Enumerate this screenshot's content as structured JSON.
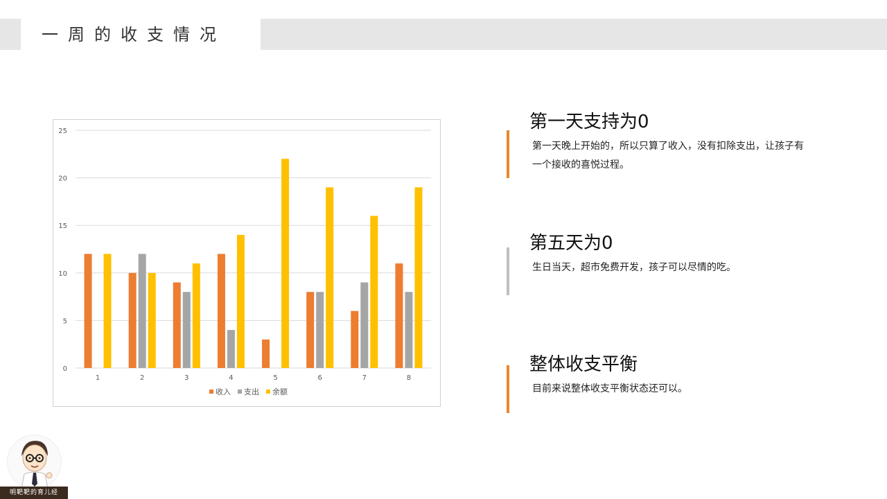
{
  "slide": {
    "title": "一周的收支情况"
  },
  "chart_data": {
    "type": "bar",
    "categories": [
      "1",
      "2",
      "3",
      "4",
      "5",
      "6",
      "7",
      "8"
    ],
    "series": [
      {
        "name": "收入",
        "color": "#ed7d31",
        "values": [
          12,
          10,
          9,
          12,
          3,
          8,
          6,
          11
        ]
      },
      {
        "name": "支出",
        "color": "#a5a5a5",
        "values": [
          0,
          12,
          8,
          4,
          0,
          8,
          9,
          8
        ]
      },
      {
        "name": "余额",
        "color": "#ffc000",
        "values": [
          12,
          10,
          11,
          14,
          22,
          19,
          16,
          19
        ]
      }
    ],
    "yticks": [
      0,
      5,
      10,
      15,
      20,
      25
    ],
    "ylim": [
      0,
      25
    ],
    "grid": true,
    "legend": "bottom"
  },
  "notes": [
    {
      "heading": "第一天支持为0",
      "body": "第一天晚上开始的，所以只算了收入，没有扣除支出，让孩子有一个接收的喜悦过程。",
      "accent": "#e8892a"
    },
    {
      "heading": "第五天为0",
      "body": "生日当天，超市免费开发，孩子可以尽情的吃。",
      "accent": "#bfbfbf"
    },
    {
      "heading": "整体收支平衡",
      "body": "目前来说整体收支平衡状态还可以。",
      "accent": "#e8892a"
    }
  ],
  "footer": {
    "logo_text": "明靶靶的育儿经"
  }
}
